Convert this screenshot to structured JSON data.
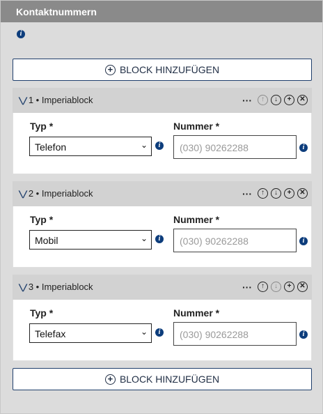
{
  "panel": {
    "title": "Kontaktnummern",
    "info_icon": "info-icon",
    "add_block_label": "BLOCK HINZUFÜGEN"
  },
  "blocks": [
    {
      "index_label": "1 • Imperiablock",
      "type_label": "Typ *",
      "number_label": "Nummer *",
      "type_value": "Telefon",
      "number_placeholder": "(030) 90262288",
      "up_disabled": true,
      "down_disabled": false
    },
    {
      "index_label": "2 • Imperiablock",
      "type_label": "Typ *",
      "number_label": "Nummer *",
      "type_value": "Mobil",
      "number_placeholder": "(030) 90262288",
      "up_disabled": false,
      "down_disabled": false
    },
    {
      "index_label": "3 • Imperiablock",
      "type_label": "Typ *",
      "number_label": "Nummer *",
      "type_value": "Telefax",
      "number_placeholder": "(030) 90262288",
      "up_disabled": false,
      "down_disabled": true
    }
  ],
  "icons": {
    "collapse": "chevron-double-down-icon",
    "more": "more-dots-icon",
    "up": "arrow-up-circle-icon",
    "down": "arrow-down-circle-icon",
    "add": "plus-circle-icon",
    "remove": "close-circle-icon",
    "select_chevron": "chevron-down-icon"
  },
  "colors": {
    "header": "#8a8a8a",
    "panel_bg": "#dcdcdc",
    "block_header": "#d2d2d2",
    "accent": "#1f3f6c",
    "info": "#0d3d7c"
  }
}
